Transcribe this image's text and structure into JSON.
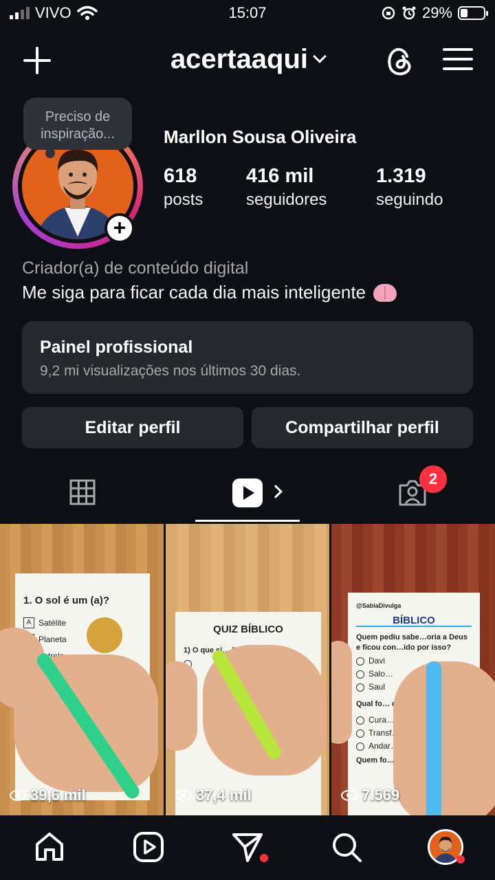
{
  "status_bar": {
    "carrier": "VIVO",
    "time": "15:07",
    "battery": "29%",
    "battery_level": 0.29,
    "icons": [
      "signal-icon",
      "wifi-icon",
      "orientation-lock-icon",
      "alarm-icon",
      "battery-icon"
    ]
  },
  "header": {
    "username": "acertaaqui",
    "icons": [
      "plus-icon",
      "chevron-down-icon",
      "threads-icon",
      "menu-icon"
    ]
  },
  "profile": {
    "note": "Preciso de inspiração...",
    "full_name": "Marllon Sousa Oliveira",
    "stats": [
      {
        "value": "618",
        "label": "posts"
      },
      {
        "value": "416 mil",
        "label": "seguidores"
      },
      {
        "value": "1.319",
        "label": "seguindo"
      }
    ],
    "category": "Criador(a) de conteúdo digital",
    "bio": "Me siga para ficar cada dia mais inteligente",
    "bio_emoji_icon": "brain-icon"
  },
  "professional_panel": {
    "title": "Painel profissional",
    "subtitle": "9,2 mi visualizações nos últimos 30 dias."
  },
  "buttons": {
    "edit": "Editar perfil",
    "share": "Compartilhar perfil"
  },
  "tabs": {
    "items": [
      "grid-icon",
      "reels-icon",
      "tagged-icon"
    ],
    "active": "reels",
    "tagged_badge": "2"
  },
  "reels": [
    {
      "views": "39,6 mil",
      "question": "1. O sol é um (a)?",
      "options": [
        {
          "key": "A",
          "text": "Satélite"
        },
        {
          "key": "B",
          "text": "Planeta"
        },
        {
          "key": "C",
          "text": "Estrela"
        }
      ]
    },
    {
      "views": "37,4 mil",
      "title": "QUIZ BÍBLICO",
      "question": "1) O que si… \"ALELUIA\"?"
    },
    {
      "views": "7.569",
      "watermark": "@SabiaDivulga",
      "title": "BÍBLICO",
      "question": "Quem pediu sabe…oria a Deus e ficou con…ido por isso?",
      "options": [
        "Davi",
        "Salo…",
        "Saul"
      ],
      "question2": "Qual fo… de Jesu…",
      "options2": [
        "Cura…",
        "Transf…",
        "Andar…"
      ],
      "footer": "Quem fo…"
    }
  ],
  "bottom_nav": {
    "items": [
      "home-icon",
      "reels-nav-icon",
      "direct-message-icon",
      "search-icon",
      "profile-avatar"
    ]
  },
  "colors": {
    "background": "#0c1014",
    "card": "#25292e",
    "badge": "#ff3040",
    "text_secondary": "#a8a8a8"
  }
}
